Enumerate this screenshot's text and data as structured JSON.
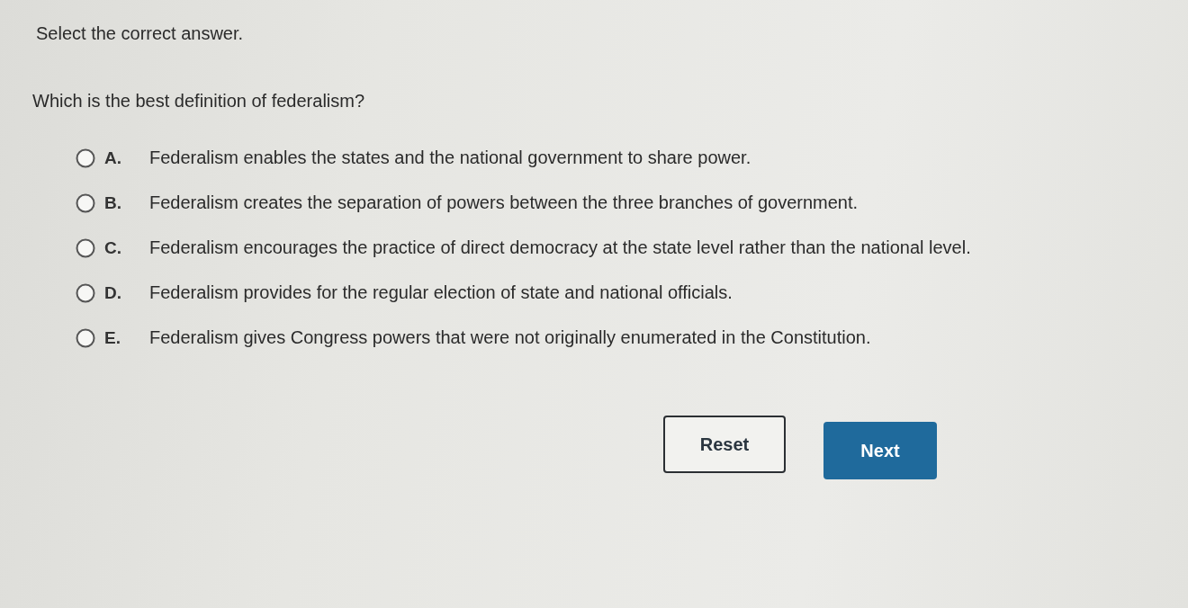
{
  "instruction": "Select the correct answer.",
  "question": "Which is the best definition of federalism?",
  "options": [
    {
      "letter": "A.",
      "text": "Federalism enables the states and the national government to share power.",
      "selected": false
    },
    {
      "letter": "B.",
      "text": "Federalism creates the separation of powers between the three branches of government.",
      "selected": false
    },
    {
      "letter": "C.",
      "text": "Federalism encourages the practice of direct democracy at the state level rather than the national level.",
      "selected": false
    },
    {
      "letter": "D.",
      "text": "Federalism provides for the regular election of state and national officials.",
      "selected": false
    },
    {
      "letter": "E.",
      "text": "Federalism gives Congress powers that were not originally enumerated in the Constitution.",
      "selected": false
    }
  ],
  "buttons": [
    {
      "label": "Reset",
      "kind": "secondary"
    },
    {
      "label": "Next",
      "kind": "primary"
    }
  ]
}
